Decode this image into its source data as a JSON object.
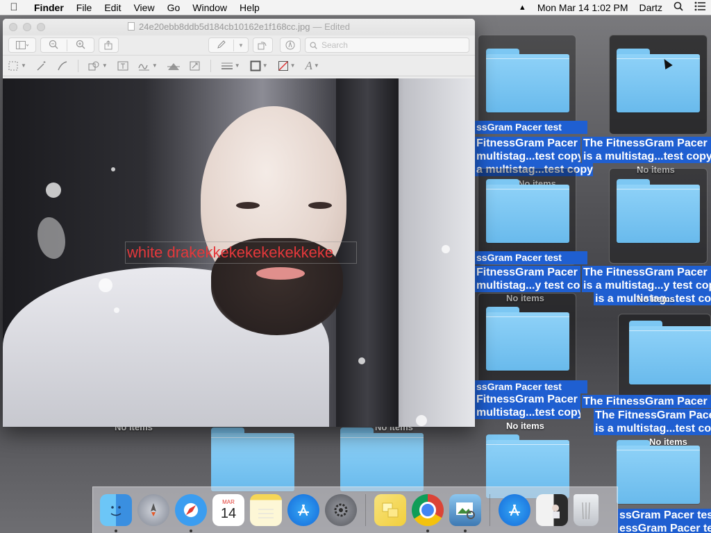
{
  "menubar": {
    "app_name": "Finder",
    "menus": [
      "File",
      "Edit",
      "View",
      "Go",
      "Window",
      "Help"
    ],
    "datetime": "Mon Mar 14  1:02 PM",
    "user": "Dartz"
  },
  "preview_window": {
    "filename": "24e20ebb8ddb5d184cb10162e1f168cc.jpg",
    "status": "— Edited",
    "search_placeholder": "Search",
    "annotation_text": "white drakekkekekekekekkeke"
  },
  "desktop": {
    "folder_labels": {
      "label_a_line1": "FitnessGram Pacer",
      "label_a_line2": "multistag...test copy",
      "label_b_line1": "The FitnessGram Pacer",
      "label_b_line2": "is a multistag...test copy",
      "label_c_line2": "multistag...y test copy",
      "label_d_line2": "is a multistag...y test copy",
      "frag_top_1": "ssGram Pacer test",
      "frag_top_2": "a multistag...test copy 49",
      "frag_mid": "ssGram Pacer test",
      "frag_mid_2": "is a multistag...test copy",
      "frag_low": "ssGram Pacer test",
      "frag_bottom": "ssGram Pacer tes",
      "frag_bottom_2": "essGram Pacer tes",
      "label_e_line1": "The FitnessGram Pace",
      "label_e_line2": "is a multistag...test co"
    },
    "no_items": "No items"
  },
  "dock": {
    "calendar_month": "MAR",
    "calendar_day": "14",
    "items": [
      "Finder",
      "Launchpad",
      "Safari",
      "Calendar",
      "Notes",
      "App Store",
      "System Preferences",
      "Stickies",
      "Google Chrome",
      "Preview",
      "App Store Downloads",
      "Image",
      "Trash"
    ]
  }
}
